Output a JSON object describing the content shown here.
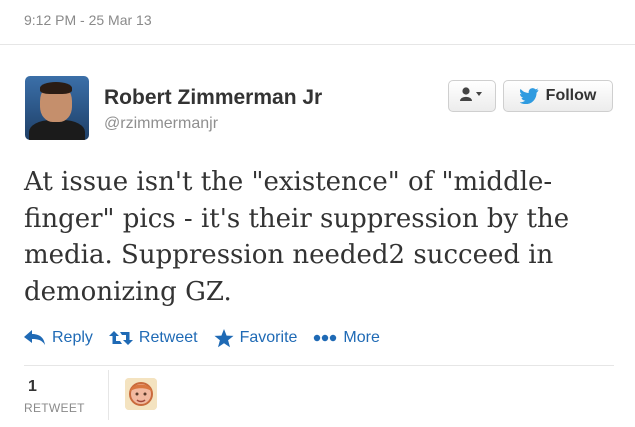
{
  "timestamp": "9:12 PM - 25 Mar 13",
  "author": {
    "name": "Robert Zimmerman Jr",
    "handle": "@rzimmermanjr"
  },
  "buttons": {
    "follow_label": "Follow"
  },
  "tweet": {
    "lines": [
      "At issue isn't the \"existence\" of \"middle-",
      "finger\" pics - it's their suppression by the",
      "media. Suppression needed2 succeed in",
      "demonizing GZ."
    ]
  },
  "actions": {
    "reply": "Reply",
    "retweet": "Retweet",
    "favorite": "Favorite",
    "more": "More"
  },
  "stats": {
    "retweet_count": "1",
    "retweet_label": "RETWEET"
  },
  "colors": {
    "link": "#1f6ab5",
    "twitter_bird": "#2f9be0"
  },
  "icons": {
    "user_dropdown": "user-dropdown-icon",
    "follow": "twitter-bird-icon",
    "reply": "reply-arrow-icon",
    "retweet": "retweet-icon",
    "favorite": "star-icon",
    "more": "dots-icon"
  }
}
